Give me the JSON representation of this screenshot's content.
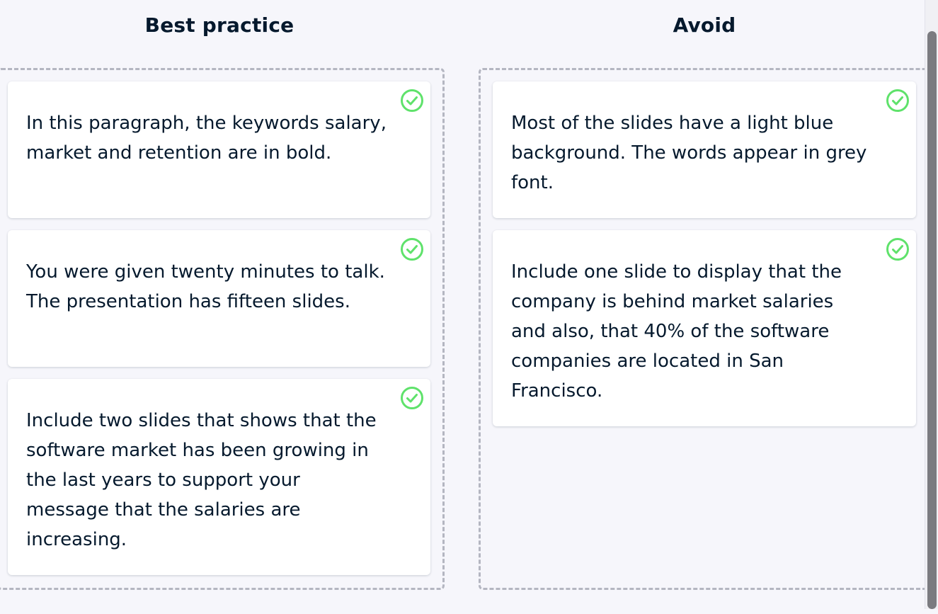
{
  "columns": {
    "best_practice": {
      "title": "Best practice",
      "cards": [
        {
          "text": "In this paragraph, the keywords salary, market and retention are in bold.",
          "status_icon": "check-circle-icon"
        },
        {
          "text": "You were given twenty minutes to talk. The presentation has fifteen slides.",
          "status_icon": "check-circle-icon"
        },
        {
          "text": "Include two slides that shows that the software market has been growing in the last years to support your message that the salaries are increasing.",
          "status_icon": "check-circle-icon"
        }
      ]
    },
    "avoid": {
      "title": "Avoid",
      "cards": [
        {
          "text": "Most of the slides have a light blue background. The words appear in grey font.",
          "status_icon": "check-circle-icon"
        },
        {
          "text": "Include one slide to display that the company is behind market salaries and also, that 40% of the software companies are located in San Francisco.",
          "status_icon": "check-circle-icon"
        }
      ]
    }
  },
  "colors": {
    "background": "#f6f6fb",
    "text": "#05192d",
    "card": "#ffffff",
    "dashed_border": "#b4b6c1",
    "check_green": "#5fe26b"
  }
}
